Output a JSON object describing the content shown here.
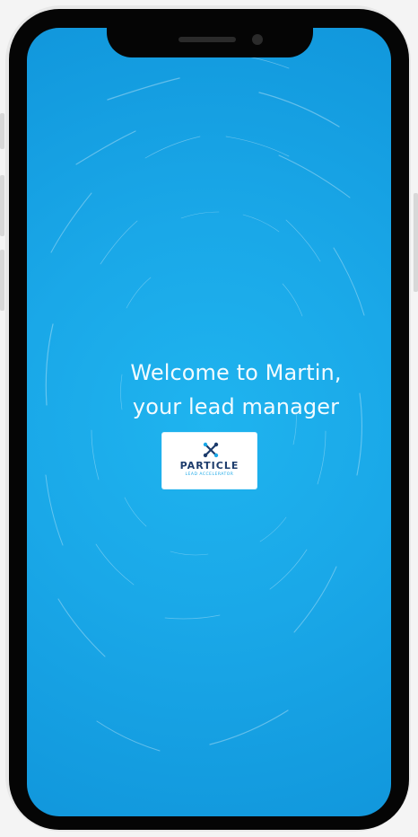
{
  "screen": {
    "welcome_line_1": "Welcome to Martin,",
    "welcome_line_2": "your lead manager"
  },
  "logo": {
    "name": "PARTICLE",
    "tagline": "LEAD ACCELERATOR",
    "icon": "particle-logo-icon"
  },
  "colors": {
    "screen_background": "#1aa8e8",
    "welcome_text": "#f2fbff",
    "logo_navy": "#1c3b6b",
    "logo_blue": "#1aa8e8"
  }
}
